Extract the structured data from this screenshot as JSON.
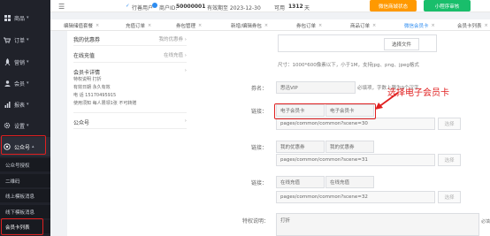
{
  "sidebar": {
    "items": [
      {
        "label": "商品",
        "icon": "grid-icon"
      },
      {
        "label": "订单",
        "icon": "cart-icon"
      },
      {
        "label": "营销",
        "icon": "rocket-icon"
      },
      {
        "label": "会员",
        "icon": "user-icon"
      },
      {
        "label": "报表",
        "icon": "chart-icon"
      },
      {
        "label": "设置",
        "icon": "gear-icon"
      },
      {
        "label": "公众号",
        "icon": "wechat-icon"
      }
    ],
    "subitems": [
      "公众号授权",
      "二维码",
      "线上模板消息",
      "线下模板消息",
      "会员卡列表"
    ]
  },
  "header": {
    "store": "行善用户",
    "pid_label": "商户ID:",
    "pid": "50000001",
    "expiry": "有效期至 2023-12-30",
    "usable_label": "可用",
    "usable_days": "1312",
    "usable_unit": "天",
    "btn_store": "微信商城状态",
    "btn_mini": "小程序审核"
  },
  "tabs": [
    {
      "label": "编辑储值套餐"
    },
    {
      "label": "充值订单"
    },
    {
      "label": "券包管理"
    },
    {
      "label": "新增/编辑券包"
    },
    {
      "label": "券包订单"
    },
    {
      "label": "商品订单"
    },
    {
      "label": "微信会员卡"
    },
    {
      "label": "会员卡列表"
    }
  ],
  "cards": {
    "my_coupon": "我的优惠券",
    "my_coupon_right": "我的优惠券",
    "online_recharge": "在线充值",
    "online_recharge_right": "在线充值",
    "member_detail": "会员卡详情",
    "details": [
      "特权说明  打折",
      "有效日期  永久有效",
      "电    话  15170495915",
      "使用须知  每人限领1张 不可转赠"
    ],
    "official": "公众号"
  },
  "form": {
    "size_hint": "尺寸：1000*600像素以下，小于1M，支持jpg、png、jpeg格式",
    "select_file": "选择文件",
    "coupon_label": "券名：",
    "coupon_value": "思迅VIP",
    "coupon_hint": "必填项，字数上限为9个汉字",
    "link_label": "链接：",
    "links": [
      {
        "name": "电子会员卡",
        "text": "电子会员卡",
        "url": "pages/common/common?scene=30"
      },
      {
        "name": "我的优惠券",
        "text": "我的优惠券",
        "url": "pages/common/common?scene=31"
      },
      {
        "name": "在线充值",
        "text": "在线充值",
        "url": "pages/common/common?scene=32"
      }
    ],
    "choose_btn": "选择",
    "privilege_label": "特权说明：",
    "privilege_value": "打折",
    "required_tail": "必填"
  },
  "annotation": {
    "text": "选择电子会员卡",
    "color": "#e02020"
  },
  "colors": {
    "sidebar": "#20222a",
    "accent": "#2d8cf0",
    "orange": "#ff9900",
    "green": "#19be6b"
  }
}
